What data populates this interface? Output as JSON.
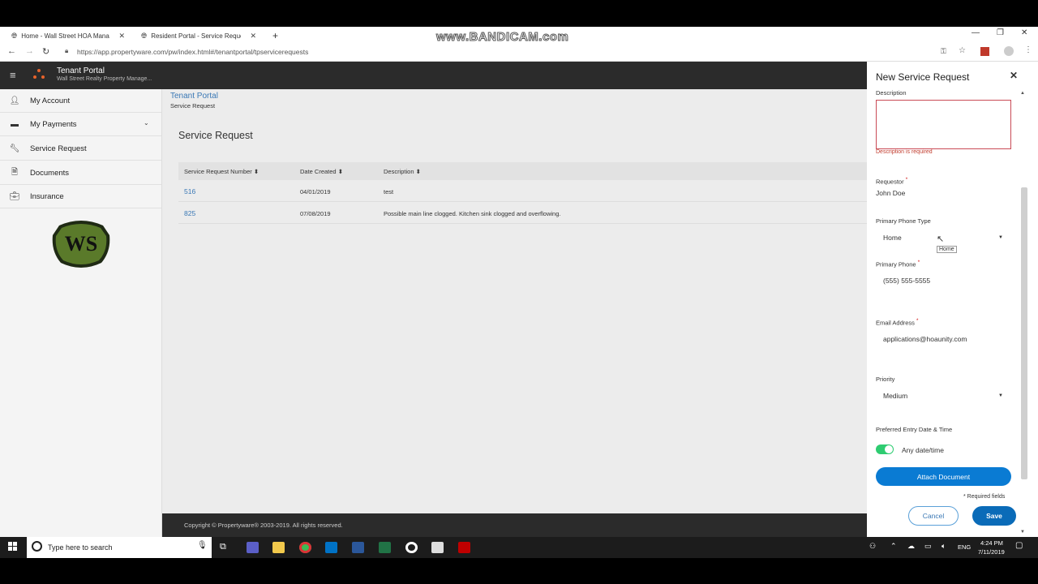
{
  "browser": {
    "tabs": [
      {
        "title": "Home - Wall Street HOA Manage",
        "active": false
      },
      {
        "title": "Resident Portal - Service Request",
        "active": true
      }
    ],
    "new_tab": "+",
    "watermark": "www.BANDICAM.com",
    "url": "https://app.propertyware.com/pw/index.html#/tenantportal/tpservicerequests",
    "window_controls": {
      "minimize": "—",
      "restore": "❐",
      "close": "✕"
    }
  },
  "app": {
    "title": "Tenant Portal",
    "subtitle": "Wall Street Realty Property Manage...",
    "breadcrumb": {
      "root": "Tenant Portal",
      "current": "Service Request"
    },
    "sidebar": [
      {
        "label": "My Account",
        "icon": "user-icon"
      },
      {
        "label": "My Payments",
        "icon": "payments-icon",
        "expandable": true
      },
      {
        "label": "Service Request",
        "icon": "wrench-icon"
      },
      {
        "label": "Documents",
        "icon": "document-icon"
      },
      {
        "label": "Insurance",
        "icon": "briefcase-icon"
      }
    ],
    "logo_text": "WS",
    "page_title": "Service Request",
    "table": {
      "headers": [
        "Service Request Number",
        "Date Created",
        "Description"
      ],
      "rows": [
        {
          "number": "516",
          "date": "04/01/2019",
          "description": "test"
        },
        {
          "number": "825",
          "date": "07/08/2019",
          "description": "Possible main line clogged. Kitchen sink clogged and overflowing."
        }
      ]
    },
    "footer": "Copyright © Propertyware® 2003-2019. All rights reserved."
  },
  "panel": {
    "title": "New Service Request",
    "description_label": "Description",
    "description_error": "Description is required",
    "requestor_label": "Requestor",
    "requestor_value": "John Doe",
    "phone_type_label": "Primary Phone Type",
    "phone_type_value": "Home",
    "phone_type_tooltip": "Home",
    "phone_label": "Primary Phone",
    "phone_value": "(555) 555-5555",
    "email_label": "Email Address",
    "email_value": "applications@hoaunity.com",
    "priority_label": "Priority",
    "priority_value": "Medium",
    "entry_label": "Preferred Entry Date & Time",
    "entry_toggle_label": "Any date/time",
    "attach_label": "Attach Document",
    "required_note": "* Required fields",
    "required_mark": "*",
    "cancel_label": "Cancel",
    "save_label": "Save",
    "colors": {
      "primary": "#0a7bd3",
      "toggle": "#2ecc71",
      "error": "#c0392b"
    }
  },
  "taskbar": {
    "search_placeholder": "Type here to search",
    "time": "4:24 PM",
    "date": "7/11/2019",
    "language": "ENG"
  }
}
